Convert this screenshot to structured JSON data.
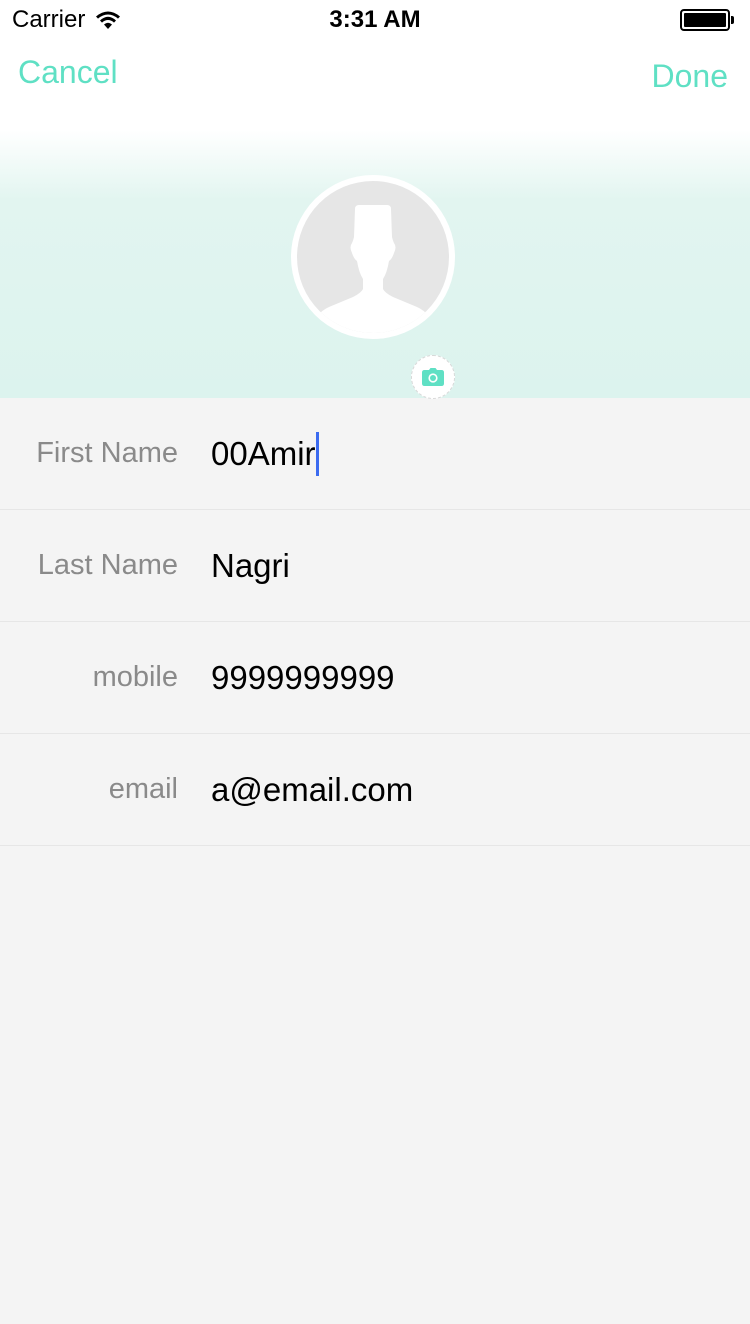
{
  "status_bar": {
    "carrier": "Carrier",
    "time": "3:31 AM",
    "wifi_icon": "wifi-icon",
    "battery_icon": "battery-icon"
  },
  "nav": {
    "cancel_label": "Cancel",
    "done_label": "Done"
  },
  "avatar": {
    "icon": "person-placeholder-icon",
    "camera_icon": "camera-icon"
  },
  "form": {
    "fields": [
      {
        "label": "First Name",
        "value": "00Amir",
        "focused": true
      },
      {
        "label": "Last Name",
        "value": "Nagri"
      },
      {
        "label": "mobile",
        "value": "9999999999"
      },
      {
        "label": "email",
        "value": "a@email.com"
      }
    ]
  },
  "colors": {
    "accent": "#5fe0c4",
    "header_gradient_bottom": "#dcf3ee",
    "background": "#f4f4f4",
    "caret": "#3b6bf0"
  }
}
